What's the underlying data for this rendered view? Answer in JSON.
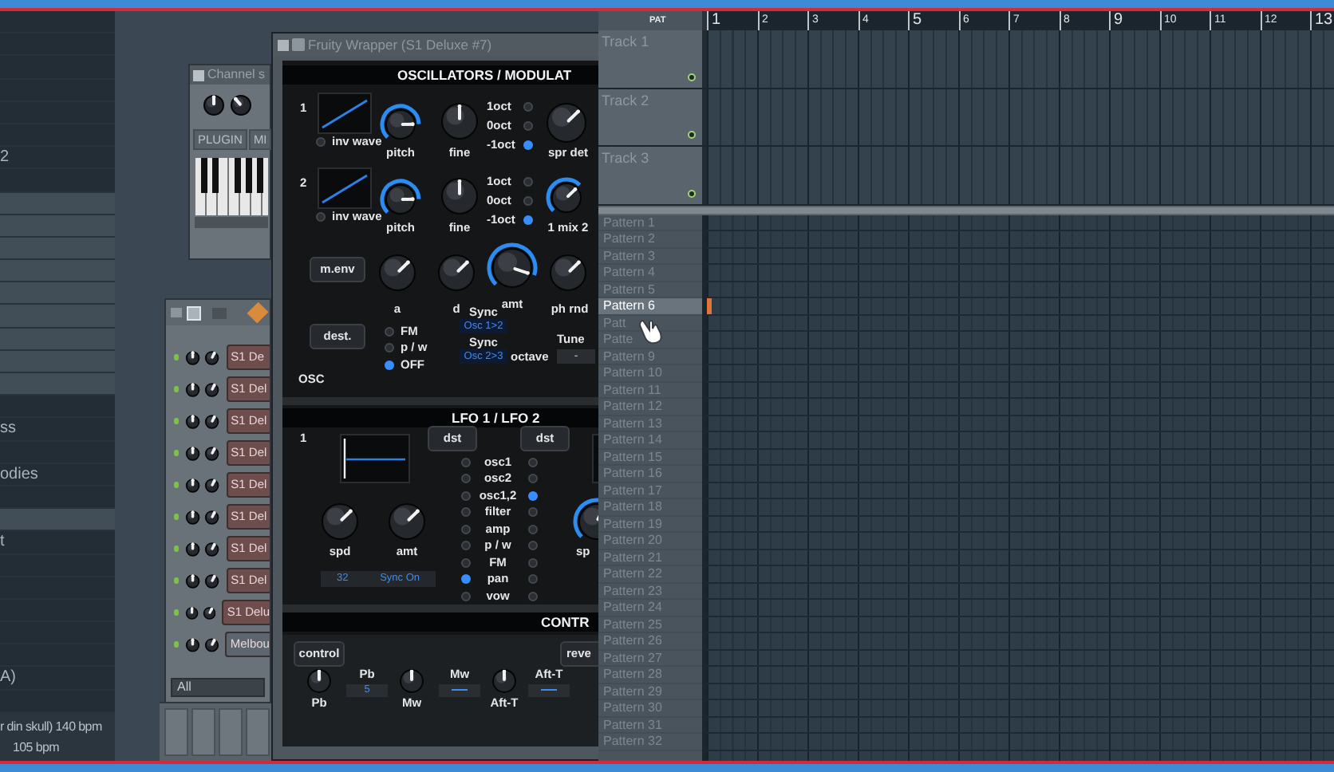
{
  "browser": {
    "items": [
      {
        "label": "2"
      },
      {
        "label": "ss"
      },
      {
        "label": "odies"
      },
      {
        "label": "t"
      },
      {
        "label": "A)"
      }
    ],
    "footer": [
      "r din skull) 140 bpm",
      "105 bpm"
    ]
  },
  "channel_settings": {
    "title": "Channel s",
    "buttons": [
      "PLUGIN",
      "MI"
    ]
  },
  "channel_rack": {
    "channels": [
      {
        "name": "S1 De",
        "color": "#6e4d4d"
      },
      {
        "name": "S1 Del",
        "color": "#6e4d4d"
      },
      {
        "name": "S1 Del",
        "color": "#6e4d4d"
      },
      {
        "name": "S1 Del",
        "color": "#6e4d4d"
      },
      {
        "name": "S1 Del",
        "color": "#6e4d4d"
      },
      {
        "name": "S1 Del",
        "color": "#6e4d4d"
      },
      {
        "name": "S1 Del",
        "color": "#6e4d4d"
      },
      {
        "name": "S1 Del",
        "color": "#6e4d4d"
      },
      {
        "name": "S1 Delu",
        "color": "#6e4d4d"
      },
      {
        "name": "Melbou",
        "color": "#5d666e"
      }
    ],
    "filter": "All"
  },
  "plugin": {
    "title": "Fruity Wrapper (S1 Deluxe #7)",
    "osc_header": "OSCILLATORS / MODULAT",
    "osc_rows": [
      {
        "number": "1",
        "wave_toggle": "inv wave",
        "knobs": [
          {
            "label": "pitch",
            "level": 0.83,
            "kind": "ring"
          },
          {
            "label": "fine",
            "level": 0.5,
            "kind": "plain"
          }
        ],
        "octaves": [
          {
            "label": "1oct",
            "selected": false
          },
          {
            "label": "0oct",
            "selected": false
          },
          {
            "label": "-1oct",
            "selected": true
          }
        ],
        "extra_knob": {
          "label": "spr det",
          "level": 0.67,
          "kind": "plain"
        }
      },
      {
        "number": "2",
        "wave_toggle": "inv wave",
        "knobs": [
          {
            "label": "pitch",
            "level": 0.83,
            "kind": "ring"
          },
          {
            "label": "fine",
            "level": 0.5,
            "kind": "plain"
          }
        ],
        "octaves": [
          {
            "label": "1oct",
            "selected": false
          },
          {
            "label": "0oct",
            "selected": false
          },
          {
            "label": "-1oct",
            "selected": true
          }
        ],
        "extra_knob": {
          "label": "1 mix 2",
          "level": 0.67,
          "kind": "ring"
        }
      }
    ],
    "mod": {
      "button": "m.env",
      "knobs": [
        {
          "label": "a",
          "level": 0.67,
          "kind": "plain"
        },
        {
          "label": "d",
          "level": 0.67,
          "kind": "plain"
        },
        {
          "label": "amt",
          "level": 0.9,
          "kind": "ring"
        },
        {
          "label": "ph rnd",
          "level": 0.67,
          "kind": "plain"
        }
      ]
    },
    "dest": {
      "button": "dest.",
      "modes": [
        {
          "label": "FM",
          "selected": false
        },
        {
          "label": "p / w",
          "selected": false
        },
        {
          "label": "OFF",
          "selected": true
        }
      ],
      "sync": [
        {
          "label": "Sync",
          "value": "Osc 1>2"
        },
        {
          "label": "Sync",
          "value": "Osc 2>3"
        }
      ],
      "octave_label": "octave",
      "tune_label": "Tune",
      "tune_value": "-",
      "section_label": "OSC"
    },
    "lfo": {
      "header": "LFO 1 / LFO 2",
      "number": "1",
      "dst_buttons": [
        "dst",
        "dst"
      ],
      "knobs": [
        {
          "label": "spd",
          "level": 0.67,
          "kind": "plain"
        },
        {
          "label": "amt",
          "level": 0.67,
          "kind": "plain"
        }
      ],
      "partial_knob": {
        "label": "sp",
        "level": 0.6,
        "kind": "ring"
      },
      "sync_display": [
        "32",
        "Sync On"
      ],
      "destinations": [
        {
          "label": "osc1",
          "lfo1": false,
          "lfo2": false
        },
        {
          "label": "osc2",
          "lfo1": false,
          "lfo2": false
        },
        {
          "label": "osc1,2",
          "lfo1": false,
          "lfo2": true
        },
        {
          "label": "filter",
          "lfo1": false,
          "lfo2": false
        },
        {
          "label": "amp",
          "lfo1": false,
          "lfo2": false
        },
        {
          "label": "p / w",
          "lfo1": false,
          "lfo2": false
        },
        {
          "label": "FM",
          "lfo1": false,
          "lfo2": false
        },
        {
          "label": "pan",
          "lfo1": true,
          "lfo2": false
        },
        {
          "label": "vow",
          "lfo1": false,
          "lfo2": false
        }
      ]
    },
    "controls": {
      "header": "CONTR",
      "buttons": [
        "control",
        "reve"
      ],
      "knobs": [
        {
          "label": "Pb",
          "level": 0.5,
          "kind": "plain"
        },
        {
          "label": "Mw",
          "level": 0.5,
          "kind": "plain"
        },
        {
          "label": "Aft-T",
          "level": 0.5,
          "kind": "plain"
        }
      ],
      "displays": [
        {
          "label": "Pb",
          "value": "5"
        },
        {
          "label": "Mw"
        },
        {
          "label": "Aft-T"
        }
      ]
    }
  },
  "playlist": {
    "view_tab": "PAT",
    "bars": [
      "1",
      "2",
      "3",
      "4",
      "5",
      "6",
      "7",
      "8",
      "9",
      "10",
      "11",
      "12",
      "13"
    ],
    "tracks": [
      "Track 1",
      "Track 2",
      "Track 3"
    ],
    "patterns": [
      {
        "label": "Pattern 1",
        "selected": false
      },
      {
        "label": "Pattern 2",
        "selected": false
      },
      {
        "label": "Pattern 3",
        "selected": false
      },
      {
        "label": "Pattern 4",
        "selected": false
      },
      {
        "label": "Pattern 5",
        "selected": false
      },
      {
        "label": "Pattern 6",
        "selected": true
      },
      {
        "label": "Patt",
        "selected": false
      },
      {
        "label": "Patte",
        "selected": false
      },
      {
        "label": "Pattern 9",
        "selected": false
      },
      {
        "label": "Pattern 10",
        "selected": false
      },
      {
        "label": "Pattern 11",
        "selected": false
      },
      {
        "label": "Pattern 12",
        "selected": false
      },
      {
        "label": "Pattern 13",
        "selected": false
      },
      {
        "label": "Pattern 14",
        "selected": false
      },
      {
        "label": "Pattern 15",
        "selected": false
      },
      {
        "label": "Pattern 16",
        "selected": false
      },
      {
        "label": "Pattern 17",
        "selected": false
      },
      {
        "label": "Pattern 18",
        "selected": false
      },
      {
        "label": "Pattern 19",
        "selected": false
      },
      {
        "label": "Pattern 20",
        "selected": false
      },
      {
        "label": "Pattern 21",
        "selected": false
      },
      {
        "label": "Pattern 22",
        "selected": false
      },
      {
        "label": "Pattern 23",
        "selected": false
      },
      {
        "label": "Pattern 24",
        "selected": false
      },
      {
        "label": "Pattern 25",
        "selected": false
      },
      {
        "label": "Pattern 26",
        "selected": false
      },
      {
        "label": "Pattern 27",
        "selected": false
      },
      {
        "label": "Pattern 28",
        "selected": false
      },
      {
        "label": "Pattern 29",
        "selected": false
      },
      {
        "label": "Pattern 30",
        "selected": false
      },
      {
        "label": "Pattern 31",
        "selected": false
      },
      {
        "label": "Pattern 32",
        "selected": false
      }
    ]
  }
}
